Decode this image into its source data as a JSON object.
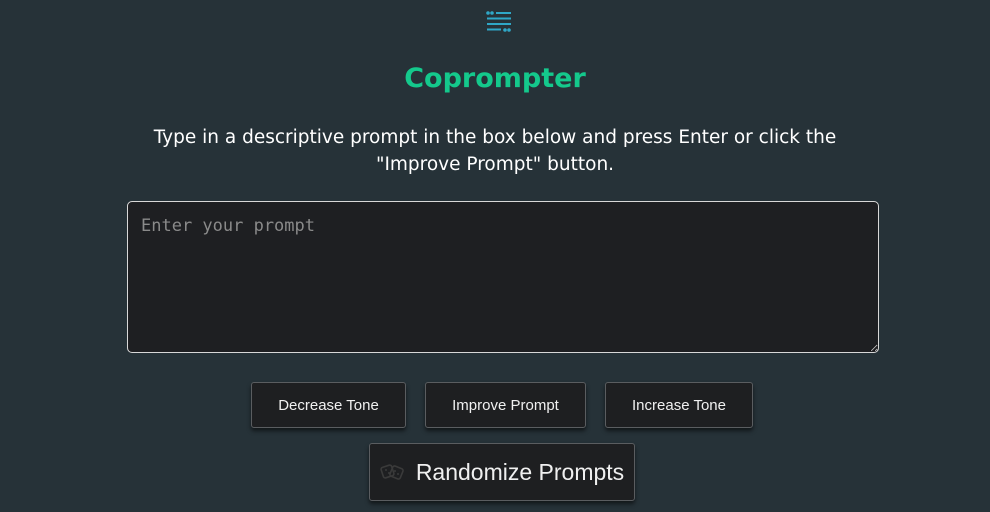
{
  "app": {
    "title": "Coprompter",
    "logo_icon": "quote-lines-icon",
    "accent_color": "#14c98c",
    "logo_color": "#2fa7c7"
  },
  "instructions": "Type in a descriptive prompt in the box below and press Enter or click the \"Improve Prompt\" button.",
  "prompt": {
    "value": "",
    "placeholder": "Enter your prompt"
  },
  "buttons": {
    "decrease_tone": "Decrease Tone",
    "improve_prompt": "Improve Prompt",
    "increase_tone": "Increase Tone",
    "randomize_prompts": "Randomize Prompts",
    "randomize_icon": "dice-icon"
  }
}
